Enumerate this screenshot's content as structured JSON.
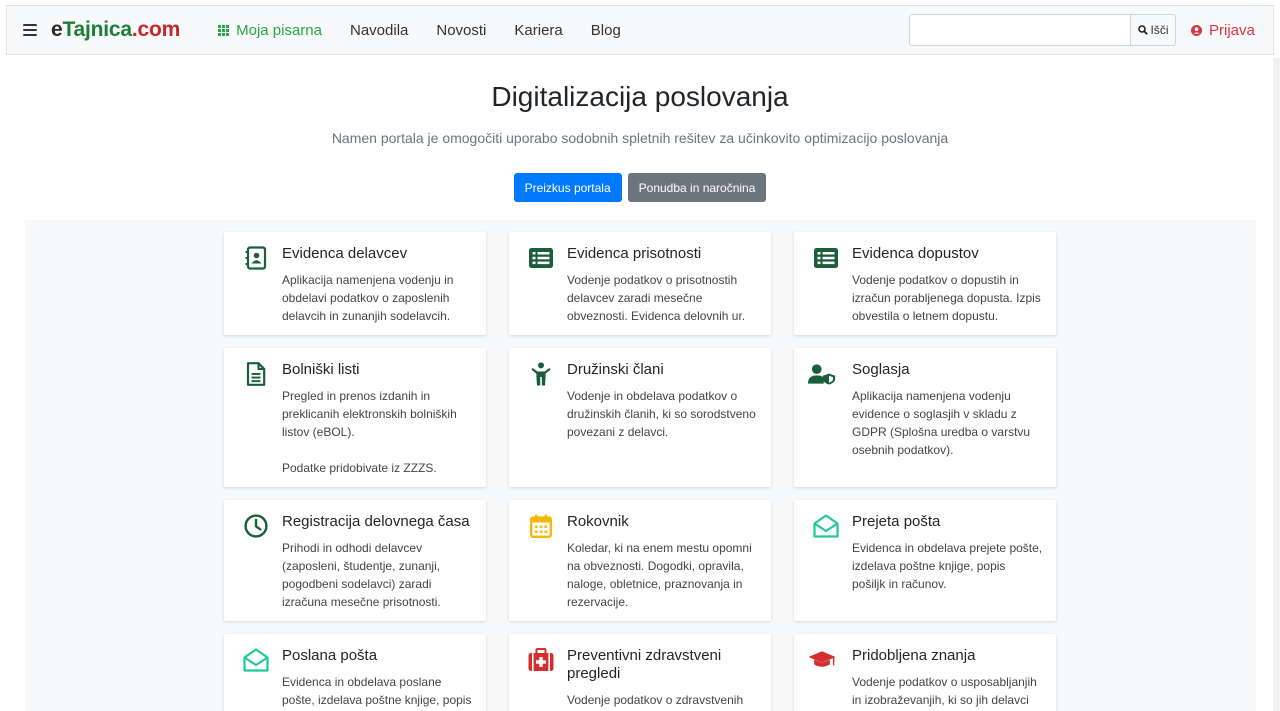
{
  "navbar": {
    "brand": {
      "part1": "e",
      "part2": "Tajnica",
      "part3": ".com"
    },
    "items": [
      {
        "label": "Moja pisarna"
      },
      {
        "label": "Navodila"
      },
      {
        "label": "Novosti"
      },
      {
        "label": "Kariera"
      },
      {
        "label": "Blog"
      }
    ],
    "search": {
      "placeholder": "",
      "button_label": "Išči"
    },
    "login_label": "Prijava"
  },
  "hero": {
    "title": "Digitalizacija poslovanja",
    "subtitle": "Namen portala je omogočiti uporabo sodobnih spletnih rešitev za učinkovito optimizacijo poslovanja",
    "primary_button": "Preizkus portala",
    "secondary_button": "Ponudba in naročnina"
  },
  "colors": {
    "brand_green": "#1e7e34",
    "brand_red": "#c62828",
    "nav_green": "#28a745",
    "primary": "#007bff",
    "secondary": "#6c757d",
    "login_red": "#dc3545"
  },
  "cards": [
    {
      "icon": "address-card-icon",
      "title": "Evidenca delavcev",
      "desc": "Aplikacija namenjena vodenju in\nobdelavi podatkov o zaposlenih\ndelavcih in zunanjih sodelavcih."
    },
    {
      "icon": "list-icon",
      "title": "Evidenca prisotnosti",
      "desc": "Vodenje podatkov o prisotnostih\ndelavcev zaradi mesečne\nobveznosti. Evidenca delovnih ur."
    },
    {
      "icon": "list-icon",
      "title": "Evidenca dopustov",
      "desc": "Vodenje podatkov o dopustih in\nizračun porabljenega dopusta. Izpis\nobvestila o letnem dopustu."
    },
    {
      "icon": "file-text-icon",
      "title": "Bolniški listi",
      "desc": "Pregled in prenos izdanih in\npreklicanih elektronskih bolniških\nlistov (eBOL).\n\nPodatke pridobivate iz ZZZS."
    },
    {
      "icon": "child-icon",
      "title": "Družinski člani",
      "desc": "Vodenje in obdelava podatkov o\ndružinskih članih, ki so sorodstveno\npovezani z delavci."
    },
    {
      "icon": "user-shield-icon",
      "title": "Soglasja",
      "desc": "Aplikacija namenjena vodenju\nevidence o soglasjih v skladu z\nGDPR (Splošna uredba o varstvu\nosebnih podatkov)."
    },
    {
      "icon": "clock-icon",
      "title": "Registracija delovnega časa",
      "desc": "Prihodi in odhodi delavcev\n(zaposleni, študentje, zunanji,\npogodbeni sodelavci) zaradi\nizračuna mesečne prisotnosti."
    },
    {
      "icon": "calendar-icon",
      "title": "Rokovnik",
      "desc": "Koledar, ki na enem mestu opomni\nna obveznosti. Dogodki, opravila,\nnaloge, obletnice, praznovanja in\nrezervacije."
    },
    {
      "icon": "envelope-open-icon",
      "title": "Prejeta pošta",
      "desc": "Evidenca in obdelava prejete pošte,\nizdelava poštne knjige, popis\npošiljk in računov."
    },
    {
      "icon": "envelope-open-icon",
      "title": "Poslana pošta",
      "desc": "Evidenca in obdelava poslane\npošte, izdelava poštne knjige, popis"
    },
    {
      "icon": "first-aid-icon",
      "title": "Preventivni zdravstveni pregledi",
      "desc": "Vodenje podatkov o zdravstvenih"
    },
    {
      "icon": "graduation-cap-icon",
      "title": "Pridobljena znanja",
      "desc": "Vodenje podatkov o usposabljanjih\nin izobraževanjih, ki so jih delavci"
    }
  ]
}
